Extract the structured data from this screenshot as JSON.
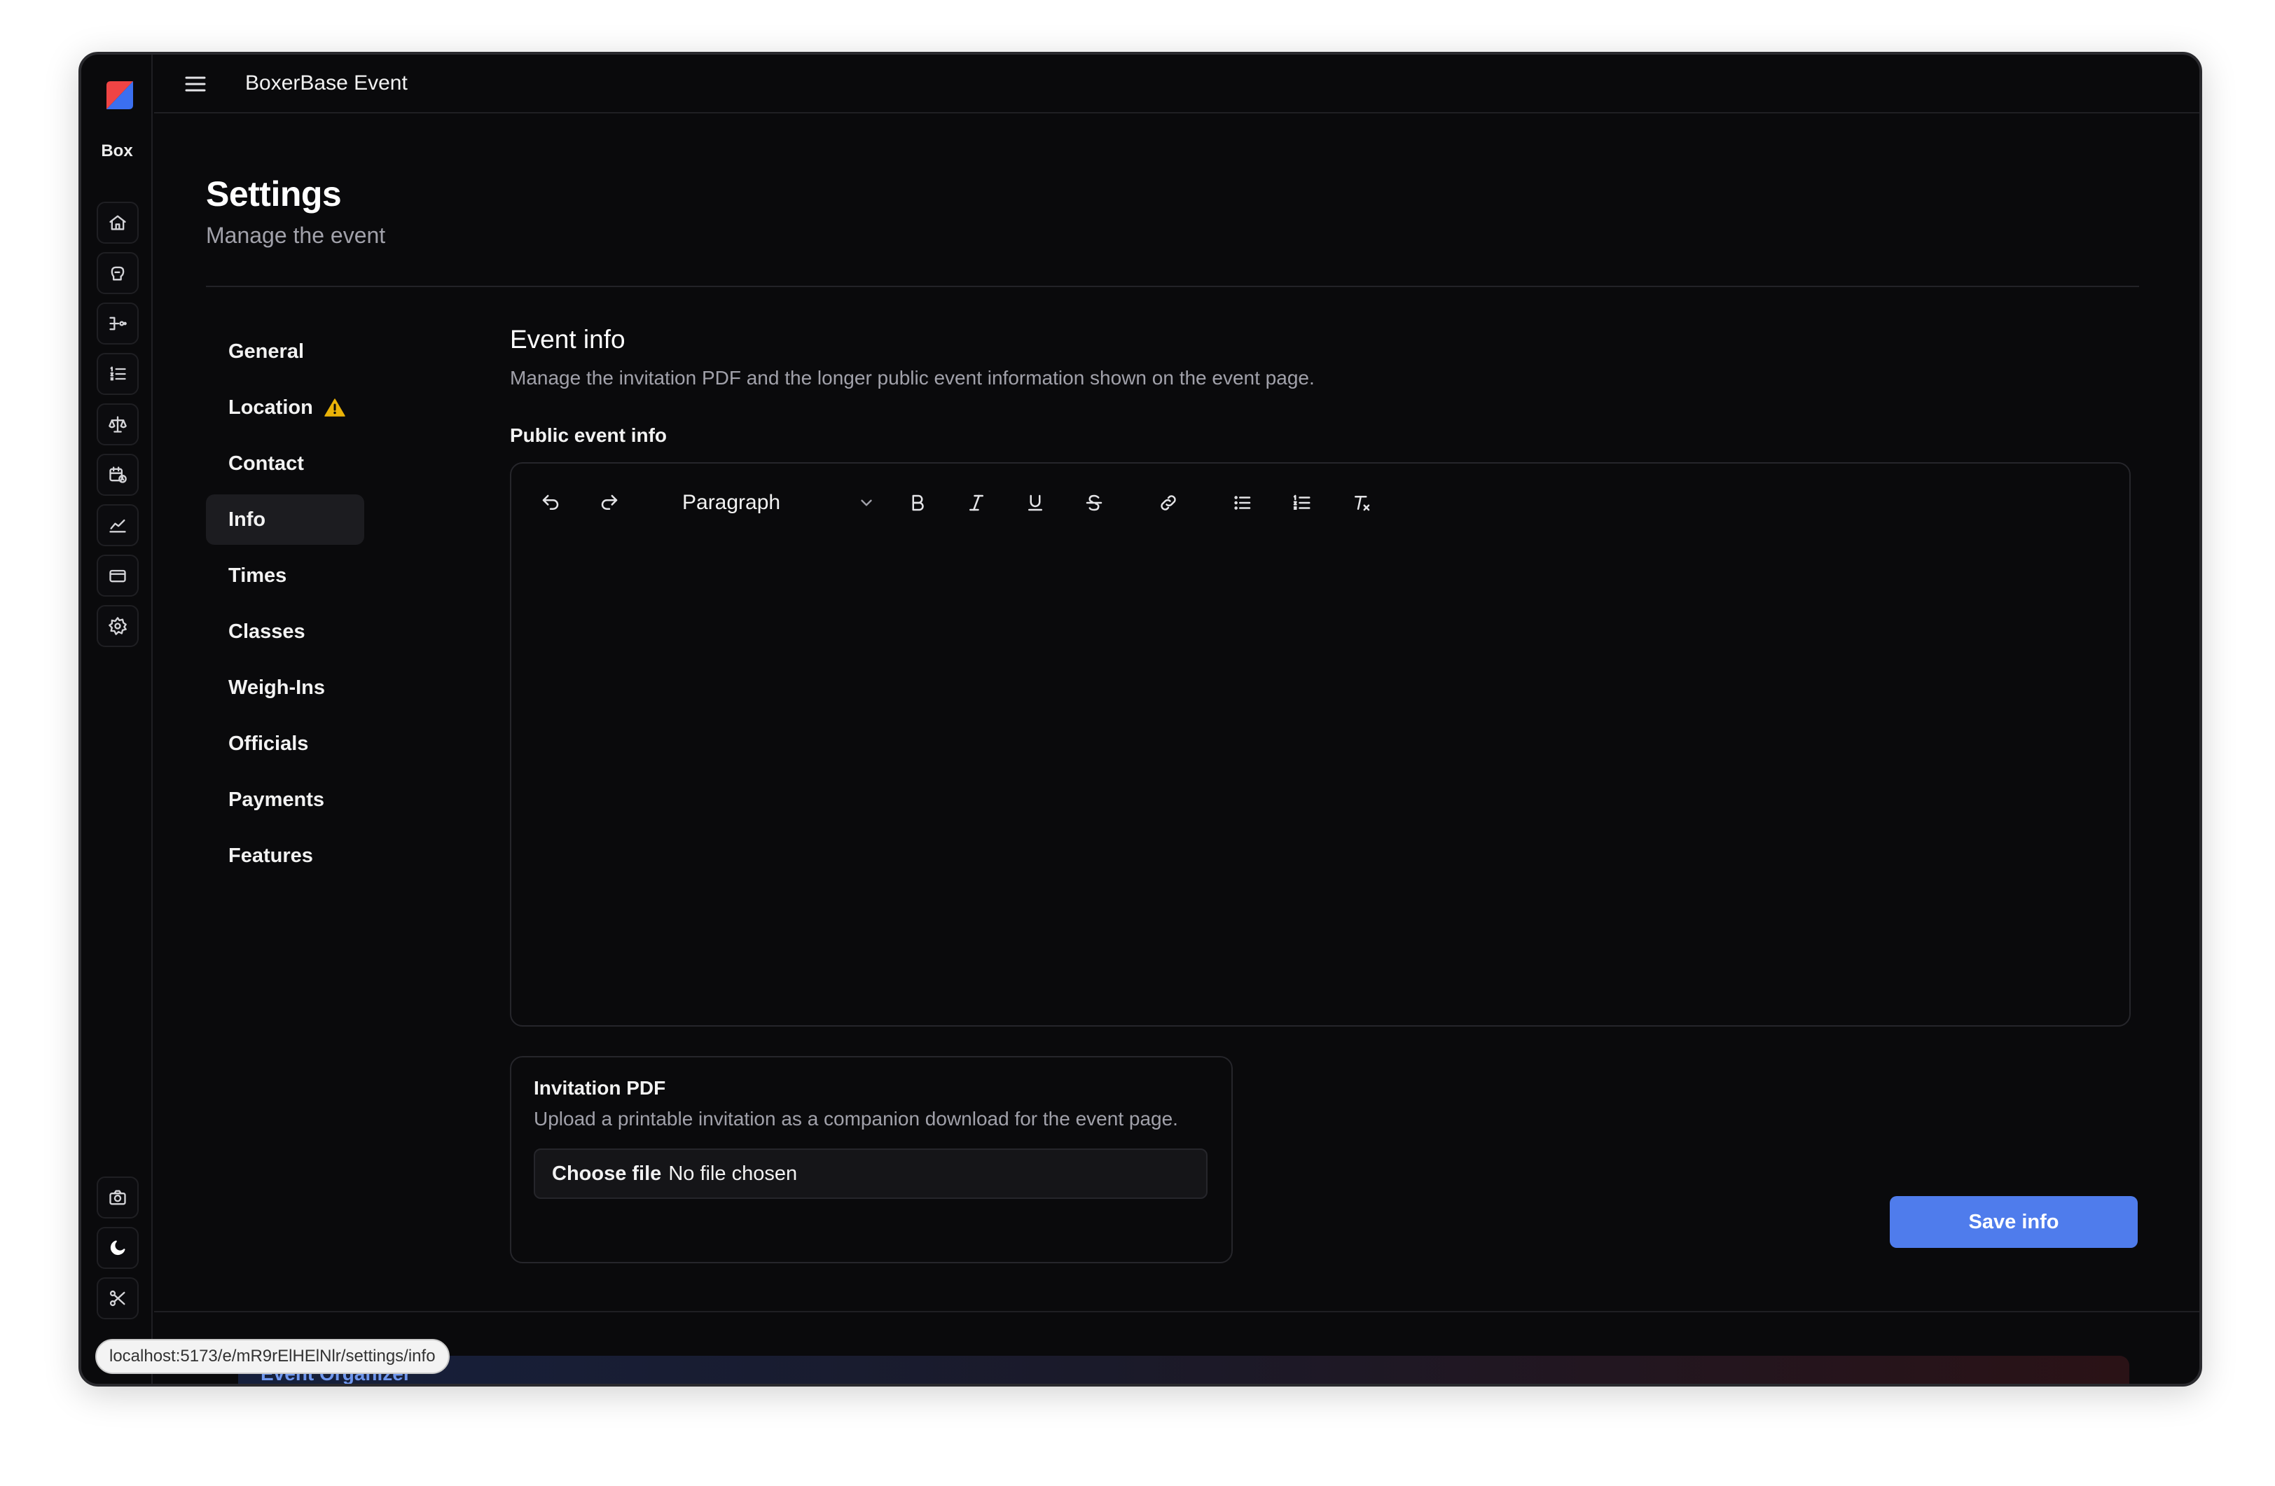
{
  "app": {
    "title": "BoxerBase Event",
    "rail_label": "Box"
  },
  "rail": {
    "items": [
      {
        "icon": "home-icon"
      },
      {
        "icon": "glove-icon"
      },
      {
        "icon": "bracket-icon"
      },
      {
        "icon": "ordered-list-icon"
      },
      {
        "icon": "scale-icon"
      },
      {
        "icon": "calendar-clock-icon"
      },
      {
        "icon": "chart-icon"
      },
      {
        "icon": "card-icon"
      },
      {
        "icon": "gear-icon"
      }
    ],
    "bottom": [
      {
        "icon": "camera-icon"
      },
      {
        "icon": "moon-icon"
      },
      {
        "icon": "scissors-icon"
      }
    ]
  },
  "header": {
    "title": "Settings",
    "subtitle": "Manage the event"
  },
  "nav": {
    "items": [
      {
        "label": "General"
      },
      {
        "label": "Location"
      },
      {
        "label": "Contact"
      },
      {
        "label": "Info"
      },
      {
        "label": "Times"
      },
      {
        "label": "Classes"
      },
      {
        "label": "Weigh-Ins"
      },
      {
        "label": "Officials"
      },
      {
        "label": "Payments"
      },
      {
        "label": "Features"
      }
    ],
    "active": "Info"
  },
  "section": {
    "title": "Event info",
    "description": "Manage the invitation PDF and the longer public event information shown on the event page.",
    "field_label": "Public event info"
  },
  "editor": {
    "block_type": "Paragraph",
    "content": ""
  },
  "invitation": {
    "title": "Invitation PDF",
    "description": "Upload a printable invitation as a companion download for the event page.",
    "choose_label": "Choose file",
    "status": "No file chosen"
  },
  "actions": {
    "save_label": "Save info"
  },
  "footer": {
    "banner_text": "Event Organizer"
  },
  "status_bar": {
    "url": "localhost:5173/e/mR9rElHElNlr/settings/info"
  },
  "colors": {
    "accent": "#4f7cec",
    "warning": "#eab308",
    "background": "#0a0a0c"
  }
}
